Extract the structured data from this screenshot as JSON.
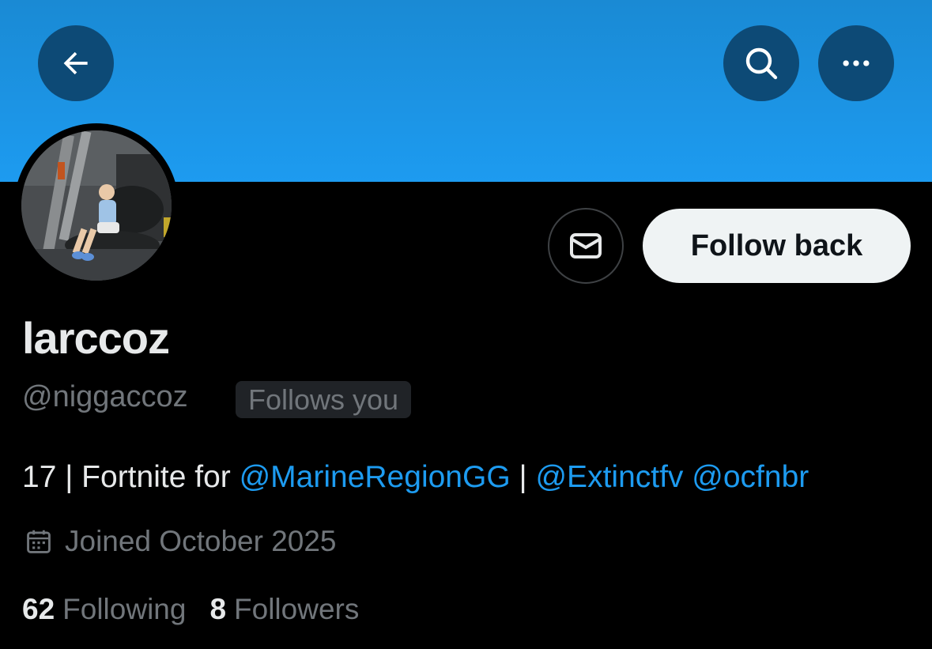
{
  "profile": {
    "display_name": "larccoz",
    "handle": "@niggaccoz",
    "follows_you_badge": "Follows you",
    "bio": {
      "prefix": "17 | Fortnite for ",
      "mention1": "@MarineRegionGG",
      "separator": " | ",
      "mention2": "@Extinctfv",
      "space": " ",
      "mention3": "@ocfnbr"
    },
    "joined": "Joined October 2025",
    "following_count": "62",
    "following_label": "Following",
    "followers_count": "8",
    "followers_label": "Followers"
  },
  "actions": {
    "follow_back_label": "Follow back"
  },
  "icons": {
    "back": "back-arrow-icon",
    "search": "search-icon",
    "more": "more-icon",
    "message": "envelope-icon",
    "calendar": "calendar-icon"
  },
  "colors": {
    "banner": "#1d9bf0",
    "accent": "#1d9bf0",
    "background": "#000000",
    "follow_button_bg": "#eff3f4"
  }
}
